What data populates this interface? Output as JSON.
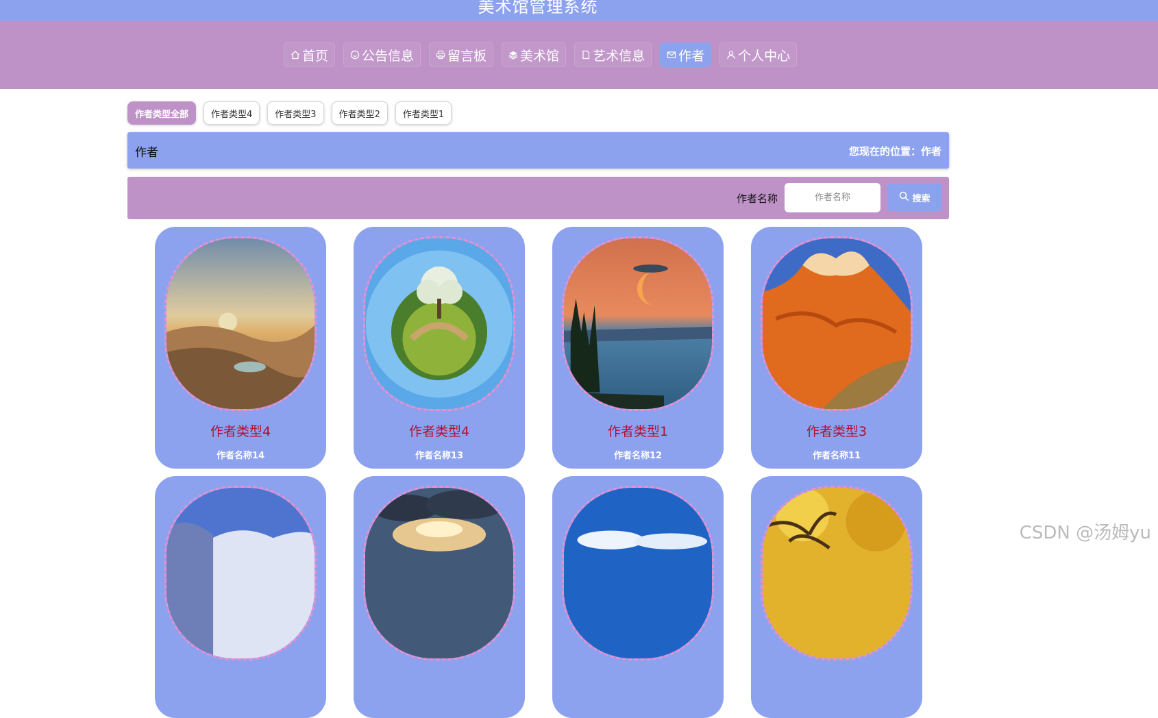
{
  "app_title": "美术馆管理系统",
  "nav": [
    {
      "label": "首页",
      "icon": "home-icon"
    },
    {
      "label": "公告信息",
      "icon": "smile-icon"
    },
    {
      "label": "留言板",
      "icon": "printer-icon"
    },
    {
      "label": "美术馆",
      "icon": "layers-icon"
    },
    {
      "label": "艺术信息",
      "icon": "document-icon"
    },
    {
      "label": "作者",
      "icon": "mail-icon",
      "active": true
    },
    {
      "label": "个人中心",
      "icon": "user-icon"
    }
  ],
  "type_filters": [
    "作者类型全部",
    "作者类型4",
    "作者类型3",
    "作者类型2",
    "作者类型1"
  ],
  "section": {
    "title": "作者",
    "breadcrumb": "您现在的位置：作者"
  },
  "search": {
    "label": "作者名称",
    "placeholder": "作者名称",
    "button": "搜索"
  },
  "cards": [
    {
      "type": "作者类型4",
      "name": "作者名称14",
      "image": "desert-oasis-sunset"
    },
    {
      "type": "作者类型4",
      "name": "作者名称13",
      "image": "tiny-planet-tree"
    },
    {
      "type": "作者类型1",
      "name": "作者名称12",
      "image": "lake-moonrise"
    },
    {
      "type": "作者类型3",
      "name": "作者名称11",
      "image": "painted-mountain"
    },
    {
      "image": "snowy-mountain"
    },
    {
      "image": "cloudy-sunset-sky"
    },
    {
      "image": "blue-sky-clouds"
    },
    {
      "image": "golden-autumn-tree"
    }
  ],
  "watermark": "CSDN @汤姆yu",
  "colors": {
    "primary": "#8da2ee",
    "secondary": "#bf92c7",
    "type_text": "#b3102e",
    "photo_border": "#e98fcf"
  }
}
